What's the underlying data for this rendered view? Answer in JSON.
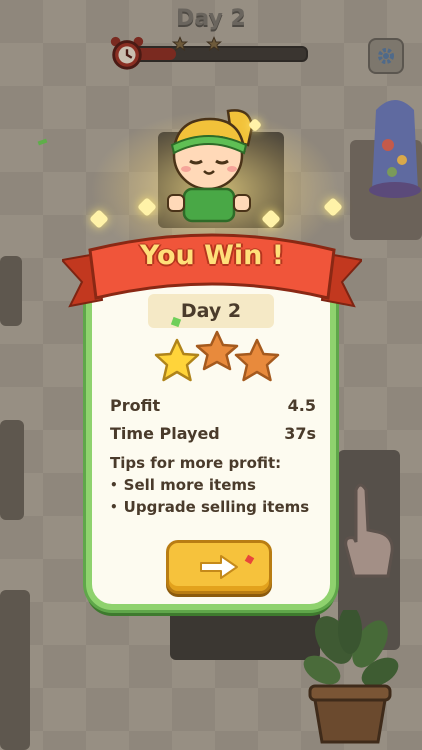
{
  "hud": {
    "day_label": "Day 2",
    "progress": 0.25,
    "icons": [
      "alarm-clock-icon",
      "star-icon",
      "star-icon",
      "gear-icon"
    ]
  },
  "result": {
    "banner_title": "You Win !",
    "day_label": "Day 2",
    "stars_earned": 1,
    "stars_total": 3,
    "stats": [
      {
        "label": "Profit",
        "value": "4.5"
      },
      {
        "label": "Time Played",
        "value": "37s"
      }
    ],
    "tips_title": "Tips for more profit:",
    "tips": [
      "Sell more items",
      "Upgrade selling items"
    ],
    "next_icon": "arrow-right-icon"
  },
  "colors": {
    "card_border": "#8fd26e",
    "ribbon": "#f0553a",
    "button": "#f6c23c",
    "star_earned": "#ffd43a",
    "star_empty": "#e88a3c"
  }
}
